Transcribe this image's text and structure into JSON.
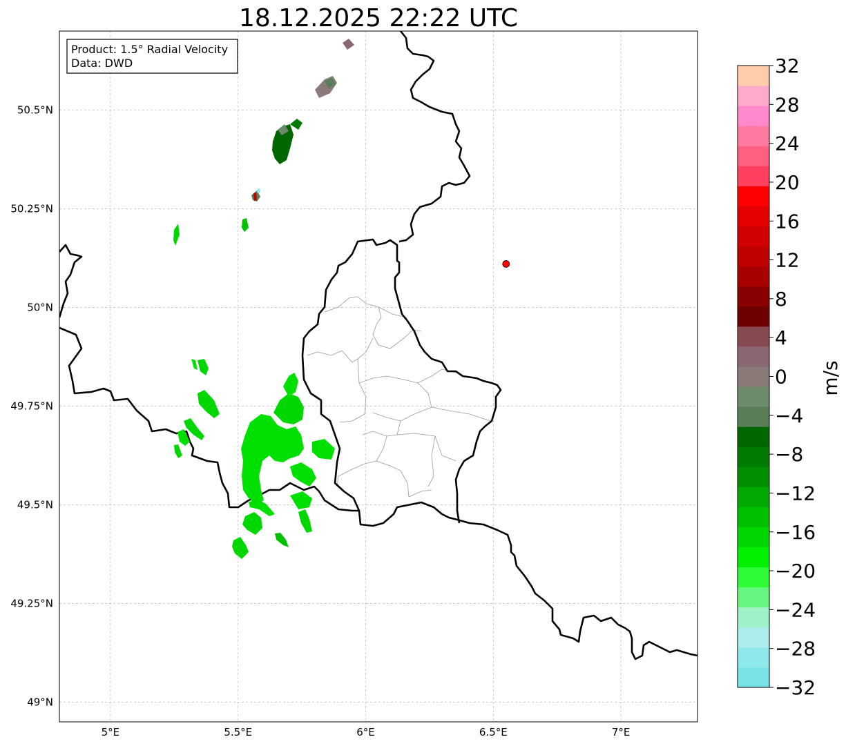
{
  "title": "18.12.2025 22:22 UTC",
  "info_box": {
    "product": "Product: 1.5° Radial Velocity",
    "data": "Data: DWD"
  },
  "map": {
    "lon_range": [
      4.8,
      7.3
    ],
    "lat_range": [
      48.95,
      50.7
    ],
    "lon_ticks": [
      {
        "value": 5.0,
        "label": "5°E"
      },
      {
        "value": 5.5,
        "label": "5.5°E"
      },
      {
        "value": 6.0,
        "label": "6°E"
      },
      {
        "value": 6.5,
        "label": "6.5°E"
      },
      {
        "value": 7.0,
        "label": "7°E"
      }
    ],
    "lat_ticks": [
      {
        "value": 49.0,
        "label": "49°N"
      },
      {
        "value": 49.25,
        "label": "49.25°N"
      },
      {
        "value": 49.5,
        "label": "49.5°N"
      },
      {
        "value": 49.75,
        "label": "49.75°N"
      },
      {
        "value": 50.0,
        "label": "50°N"
      },
      {
        "value": 50.25,
        "label": "50.25°N"
      },
      {
        "value": 50.5,
        "label": "50.5°N"
      }
    ],
    "radar_site": {
      "lon": 6.55,
      "lat": 50.11,
      "color": "#ff0000"
    },
    "grid": true
  },
  "colorbar": {
    "label": "m/s",
    "min": -32,
    "max": 32,
    "tick_labels": [
      {
        "value": 32,
        "label": "32"
      },
      {
        "value": 28,
        "label": "28"
      },
      {
        "value": 24,
        "label": "24"
      },
      {
        "value": 20,
        "label": "20"
      },
      {
        "value": 16,
        "label": "16"
      },
      {
        "value": 12,
        "label": "12"
      },
      {
        "value": 8,
        "label": "8"
      },
      {
        "value": 4,
        "label": "4"
      },
      {
        "value": 0,
        "label": "0"
      },
      {
        "value": -4,
        "label": "−4"
      },
      {
        "value": -8,
        "label": "−8"
      },
      {
        "value": -12,
        "label": "−12"
      },
      {
        "value": -16,
        "label": "−16"
      },
      {
        "value": -20,
        "label": "−20"
      },
      {
        "value": -24,
        "label": "−24"
      },
      {
        "value": -28,
        "label": "−28"
      },
      {
        "value": -32,
        "label": "−32"
      }
    ],
    "colors_bottom_to_top": [
      "#7ae3e8",
      "#8fe8ea",
      "#aeeced",
      "#9ff2c8",
      "#66f57f",
      "#2efc38",
      "#00f000",
      "#00d600",
      "#00c000",
      "#00aa00",
      "#008f00",
      "#007a00",
      "#006600",
      "#5a7f58",
      "#6d8a6c",
      "#8a7a78",
      "#8a6872",
      "#864a50",
      "#6e0000",
      "#8a0000",
      "#a60000",
      "#be0000",
      "#d20000",
      "#e40000",
      "#ff0000",
      "#ff4060",
      "#ff6080",
      "#ff7aa0",
      "#ff88cc",
      "#ffaacc",
      "#ffccaa"
    ]
  }
}
